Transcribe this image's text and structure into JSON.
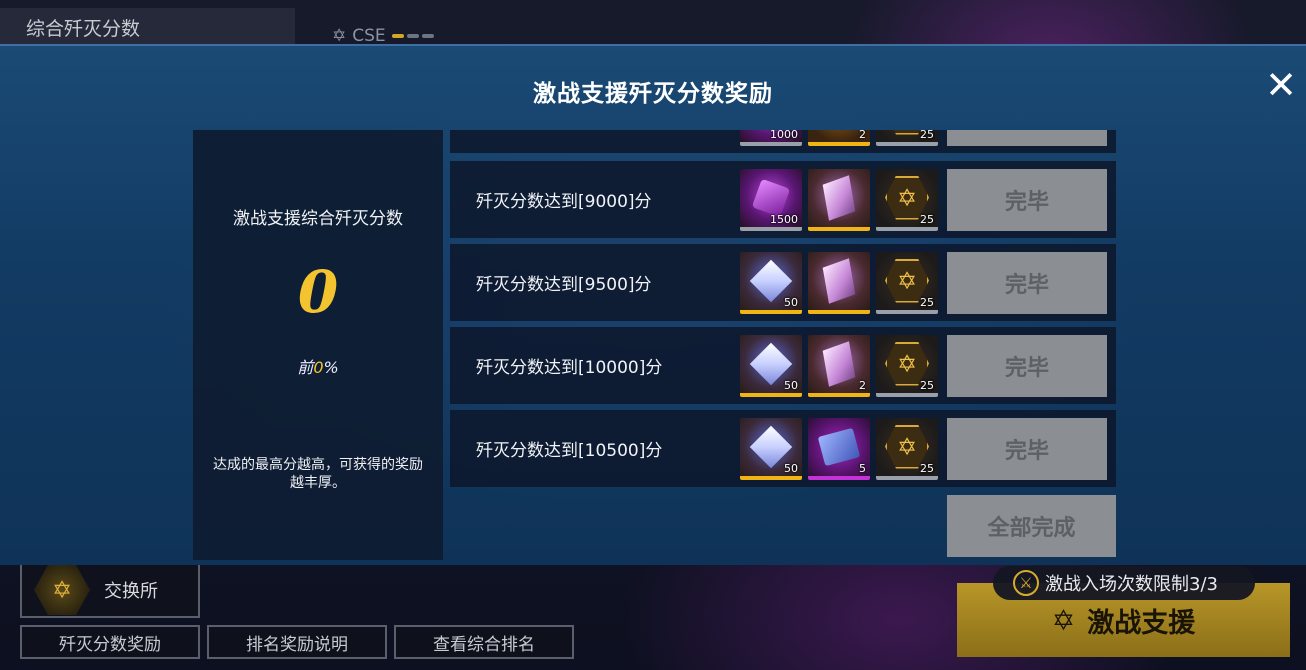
{
  "background": {
    "title": "综合歼灭分数",
    "cse_label": "CSE",
    "exchange_label": "交换所",
    "buttons": [
      "歼灭分数奖励",
      "排名奖励说明",
      "查看综合排名"
    ],
    "entry_limit": "激战入场次数限制3/3",
    "support_button": "激战支援"
  },
  "modal": {
    "title": "激战支援歼灭分数奖励",
    "close_icon": "close-icon",
    "left_panel": {
      "heading": "激战支援综合歼灭分数",
      "score": "0",
      "rank_prefix": "前",
      "rank_value": "0",
      "rank_suffix": "%",
      "description": "达成的最高分越高，可获得的奖励越丰厚。"
    },
    "rewards": [
      {
        "condition": "",
        "items": [
          {
            "icon": "purple-crystal-icon",
            "count": "1000",
            "rarity": "grey"
          },
          {
            "icon": "gold-pile-icon",
            "count": "2",
            "rarity": "gold"
          },
          {
            "icon": "star-badge-icon",
            "count": "25",
            "rarity": "grey"
          }
        ],
        "status": ""
      },
      {
        "condition": "歼灭分数达到[9000]分",
        "items": [
          {
            "icon": "purple-crystal-icon",
            "count": "1500",
            "rarity": "grey"
          },
          {
            "icon": "pink-crystal-icon",
            "count": "",
            "rarity": "gold"
          },
          {
            "icon": "star-badge-icon",
            "count": "25",
            "rarity": "grey"
          }
        ],
        "status": "完毕"
      },
      {
        "condition": "歼灭分数达到[9500]分",
        "items": [
          {
            "icon": "white-crystal-icon",
            "count": "50",
            "rarity": "gold"
          },
          {
            "icon": "pink-crystal-icon",
            "count": "",
            "rarity": "gold"
          },
          {
            "icon": "star-badge-icon",
            "count": "25",
            "rarity": "grey"
          }
        ],
        "status": "完毕"
      },
      {
        "condition": "歼灭分数达到[10000]分",
        "items": [
          {
            "icon": "white-crystal-icon",
            "count": "50",
            "rarity": "gold"
          },
          {
            "icon": "pink-crystal-icon",
            "count": "2",
            "rarity": "gold"
          },
          {
            "icon": "star-badge-icon",
            "count": "25",
            "rarity": "grey"
          }
        ],
        "status": "完毕"
      },
      {
        "condition": "歼灭分数达到[10500]分",
        "items": [
          {
            "icon": "white-crystal-icon",
            "count": "50",
            "rarity": "gold"
          },
          {
            "icon": "scroll-icon",
            "count": "5",
            "rarity": "purple"
          },
          {
            "icon": "star-badge-icon",
            "count": "25",
            "rarity": "grey"
          }
        ],
        "status": "完毕"
      }
    ],
    "all_done_label": "全部完成"
  }
}
